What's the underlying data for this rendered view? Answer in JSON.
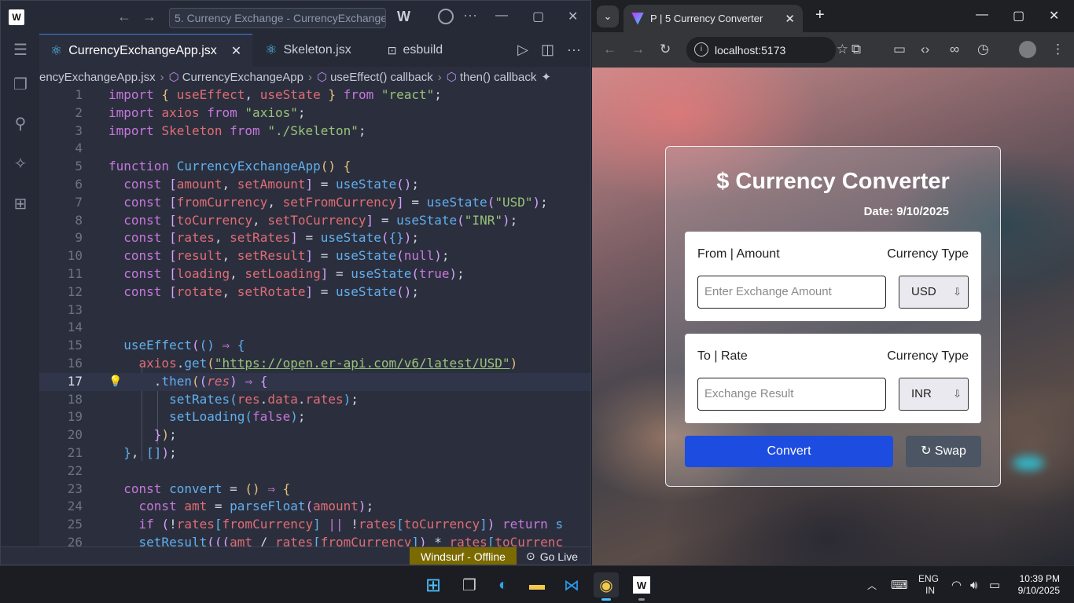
{
  "editor": {
    "search_text": "5. Currency Exchange - CurrencyExchangeA",
    "brand": "W",
    "tabs": [
      {
        "label": "CurrencyExchangeApp.jsx",
        "close": "✕"
      },
      {
        "label": "Skeleton.jsx"
      },
      {
        "label": "esbuild"
      }
    ],
    "breadcrumb": [
      "encyExchangeApp.jsx",
      "CurrencyExchangeApp",
      "useEffect() callback",
      "then() callback"
    ],
    "code_lines": [
      {
        "n": "1",
        "html": "<span class=\"kw\">import</span> <span class=\"br\">{</span> <span class=\"var\">useEffect</span>, <span class=\"var\">useState</span> <span class=\"br\">}</span> <span class=\"kw\">from</span> <span class=\"str\">\"react\"</span>;"
      },
      {
        "n": "2",
        "html": "<span class=\"kw\">import</span> <span class=\"var\">axios</span> <span class=\"kw\">from</span> <span class=\"str\">\"axios\"</span>;"
      },
      {
        "n": "3",
        "html": "<span class=\"kw\">import</span> <span class=\"var\">Skeleton</span> <span class=\"kw\">from</span> <span class=\"str\">\"./Skeleton\"</span>;"
      },
      {
        "n": "4",
        "html": ""
      },
      {
        "n": "5",
        "html": "<span class=\"kw\">function</span> <span class=\"fn\">CurrencyExchangeApp</span><span class=\"br\">()</span> <span class=\"br\">{</span>"
      },
      {
        "n": "6",
        "html": "  <span class=\"kw\">const</span> <span class=\"pa\">[</span><span class=\"var\">amount</span>, <span class=\"var\">setAmount</span><span class=\"pa\">]</span> = <span class=\"fn\">useState</span><span class=\"pa\">()</span>;"
      },
      {
        "n": "7",
        "html": "  <span class=\"kw\">const</span> <span class=\"pa\">[</span><span class=\"var\">fromCurrency</span>, <span class=\"var\">setFromCurrency</span><span class=\"pa\">]</span> = <span class=\"fn\">useState</span><span class=\"pa\">(</span><span class=\"str\">\"USD\"</span><span class=\"pa\">)</span>;"
      },
      {
        "n": "8",
        "html": "  <span class=\"kw\">const</span> <span class=\"pa\">[</span><span class=\"var\">toCurrency</span>, <span class=\"var\">setToCurrency</span><span class=\"pa\">]</span> = <span class=\"fn\">useState</span><span class=\"pa\">(</span><span class=\"str\">\"INR\"</span><span class=\"pa\">)</span>;"
      },
      {
        "n": "9",
        "html": "  <span class=\"kw\">const</span> <span class=\"pa\">[</span><span class=\"var\">rates</span>, <span class=\"var\">setRates</span><span class=\"pa\">]</span> = <span class=\"fn\">useState</span><span class=\"pa\">(</span><span class=\"fn\">{}</span><span class=\"pa\">)</span>;"
      },
      {
        "n": "10",
        "html": "  <span class=\"kw\">const</span> <span class=\"pa\">[</span><span class=\"var\">result</span>, <span class=\"var\">setResult</span><span class=\"pa\">]</span> = <span class=\"fn\">useState</span><span class=\"pa\">(</span><span class=\"kw\">null</span><span class=\"pa\">)</span>;"
      },
      {
        "n": "11",
        "html": "  <span class=\"kw\">const</span> <span class=\"pa\">[</span><span class=\"var\">loading</span>, <span class=\"var\">setLoading</span><span class=\"pa\">]</span> = <span class=\"fn\">useState</span><span class=\"pa\">(</span><span class=\"kw\">true</span><span class=\"pa\">)</span>;"
      },
      {
        "n": "12",
        "html": "  <span class=\"kw\">const</span> <span class=\"pa\">[</span><span class=\"var\">rotate</span>, <span class=\"var\">setRotate</span><span class=\"pa\">]</span> = <span class=\"fn\">useState</span><span class=\"pa\">()</span>;"
      },
      {
        "n": "13",
        "html": ""
      },
      {
        "n": "14",
        "html": ""
      },
      {
        "n": "15",
        "html": "  <span class=\"fn\">useEffect</span><span class=\"pa\">(</span><span class=\"fn\">()</span> <span class=\"kw\">⇒</span> <span class=\"fn\">{</span>"
      },
      {
        "n": "16",
        "html": "    <span class=\"var\">axios</span>.<span class=\"fn\">get</span><span class=\"id\">(</span><span class=\"url\">\"https://open.er-api.com/v6/latest/USD\"</span><span class=\"id\">)</span>"
      },
      {
        "n": "17",
        "html": "      .<span class=\"fn\">then</span><span class=\"id\">(</span><span class=\"pa\">(</span><span class=\"it\">res</span><span class=\"pa\">)</span> <span class=\"kw\">⇒</span> <span class=\"pa\">{</span>"
      },
      {
        "n": "18",
        "html": "        <span class=\"fn\">setRates</span><span class=\"fn\">(</span><span class=\"var\">res</span>.<span class=\"var\">data</span>.<span class=\"var\">rates</span><span class=\"fn\">)</span>;"
      },
      {
        "n": "19",
        "html": "        <span class=\"fn\">setLoading</span><span class=\"fn\">(</span><span class=\"kw\">false</span><span class=\"fn\">)</span>;"
      },
      {
        "n": "20",
        "html": "      <span class=\"pa\">}</span><span class=\"id\">)</span>;"
      },
      {
        "n": "21",
        "html": "  <span class=\"fn\">}</span>, <span class=\"fn\">[]</span><span class=\"pa\">)</span>;"
      },
      {
        "n": "22",
        "html": ""
      },
      {
        "n": "23",
        "html": "  <span class=\"kw\">const</span> <span class=\"fn\">convert</span> = <span class=\"br\">()</span> <span class=\"kw\">⇒</span> <span class=\"br\">{</span>"
      },
      {
        "n": "24",
        "html": "    <span class=\"kw\">const</span> <span class=\"var\">amt</span> = <span class=\"fn\">parseFloat</span><span class=\"pa\">(</span><span class=\"var\">amount</span><span class=\"pa\">)</span>;"
      },
      {
        "n": "25",
        "html": "    <span class=\"kw\">if</span> <span class=\"pa\">(</span>!<span class=\"var\">rates</span><span class=\"fn\">[</span><span class=\"var\">fromCurrency</span><span class=\"fn\">]</span> <span class=\"kw\">||</span> !<span class=\"var\">rates</span><span class=\"fn\">[</span><span class=\"var\">toCurrency</span><span class=\"fn\">]</span><span class=\"pa\">)</span> <span class=\"kw\">return</span> <span class=\"fn\">s</span>"
      },
      {
        "n": "26",
        "html": "    <span class=\"fn\">setResult</span><span class=\"pa\">(((</span><span class=\"var\">amt</span> / <span class=\"var\">rates</span><span class=\"fn\">[</span><span class=\"var\">fromCurrency</span><span class=\"fn\">]</span><span class=\"pa\">)</span> * <span class=\"var\">rates</span><span class=\"fn\">[</span><span class=\"var\">toCurrenc</span>"
      }
    ],
    "status_offline": "Windsurf - Offline",
    "status_golive": "Go Live"
  },
  "browser": {
    "tab_title": "P | 5 Currency Converter",
    "url": "localhost:5173"
  },
  "app": {
    "title": "$ Currency Converter",
    "date": "Date: 9/10/2025",
    "from_label": "From | Amount",
    "to_label": "To | Rate",
    "currency_type_label": "Currency Type",
    "amount_placeholder": "Enter Exchange Amount",
    "result_placeholder": "Exchange Result",
    "from_currency": "USD",
    "to_currency": "INR",
    "convert_label": "Convert",
    "swap_label": "↻ Swap"
  },
  "taskbar": {
    "lang": "ENG",
    "region": "IN",
    "time": "10:39 PM",
    "date": "9/10/2025"
  }
}
